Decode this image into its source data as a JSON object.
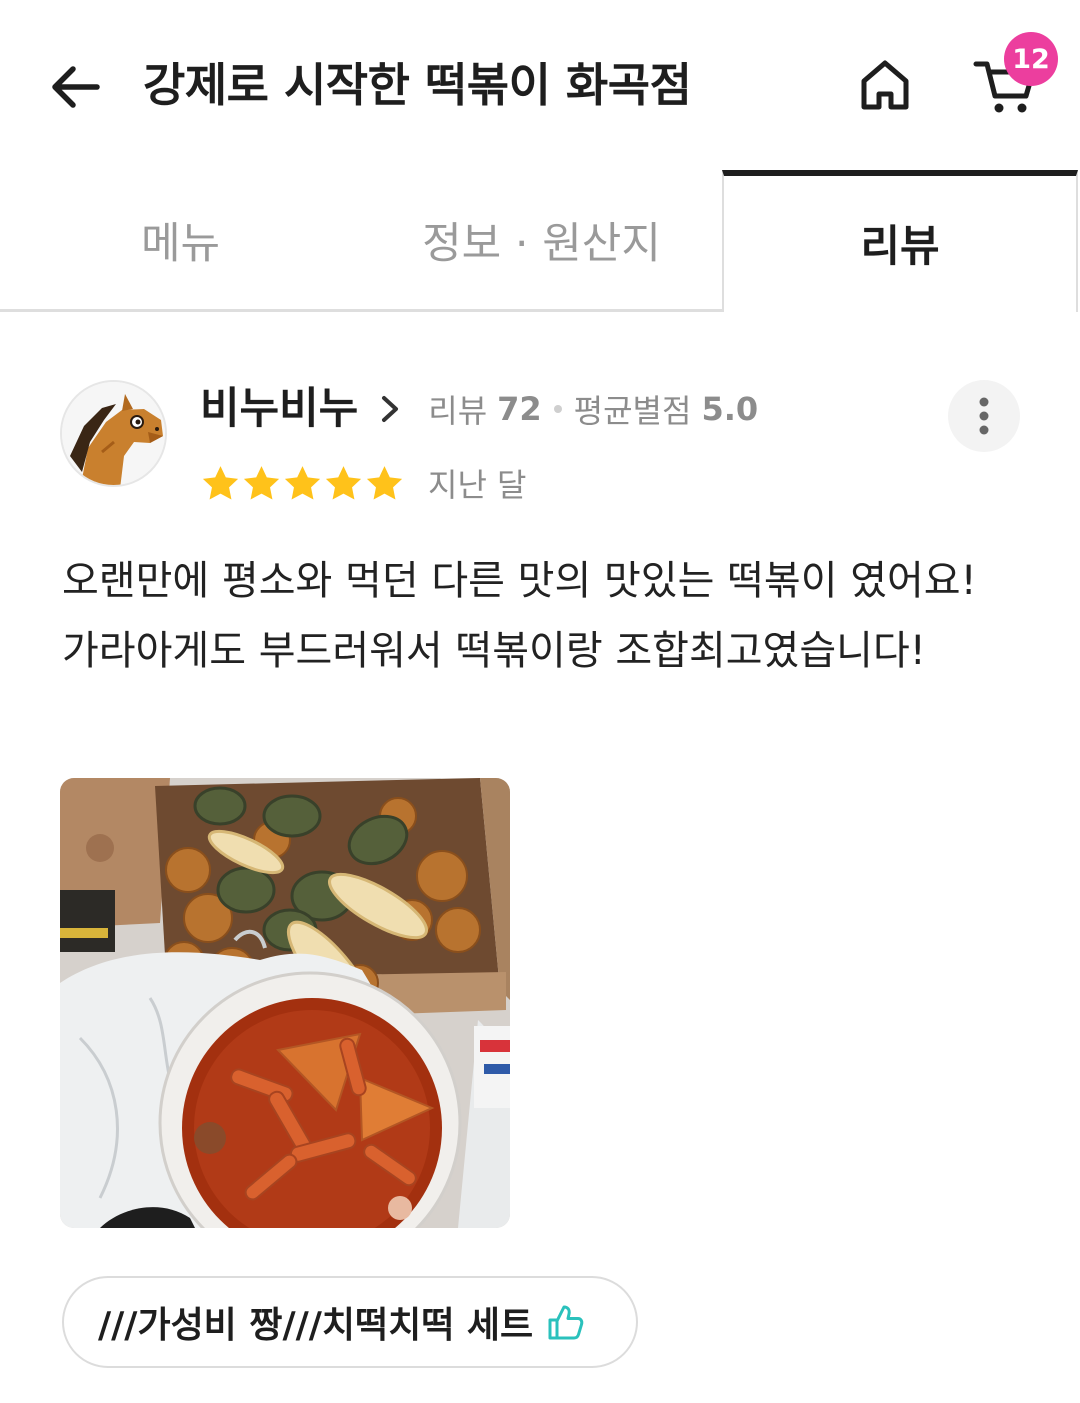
{
  "header": {
    "title": "강제로 시작한 떡볶이 화곡점",
    "cart_count": "12"
  },
  "tabs": [
    {
      "label": "메뉴",
      "active": false
    },
    {
      "label": "정보 · 원산지",
      "active": false
    },
    {
      "label": "리뷰",
      "active": true
    }
  ],
  "review": {
    "author": "비누비누",
    "review_count_label": "리뷰",
    "review_count": "72",
    "avg_rating_label": "평균별점",
    "avg_rating": "5.0",
    "rating": 5,
    "rating_max": 5,
    "date": "지난 달",
    "text": "오랜만에 평소와 먹던 다른 맛의 맛있는 떡볶이 였어요! 가라아게도 부드러워서 떡볶이랑 조합최고였습니다!",
    "menu_tag": "///가성비 짱///치떡치떡 세트"
  },
  "icons": {
    "back": "arrow-left-icon",
    "home": "home-icon",
    "cart": "cart-icon",
    "author_link": "chevron-right-icon",
    "more": "more-vertical-icon",
    "star": "star-icon",
    "menu_tag": "thumbs-up-icon"
  },
  "colors": {
    "text_primary": "#1e1e1e",
    "text_secondary": "#8c8c8c",
    "badge": "#ec3e9e",
    "star": "#ffc21a",
    "star_empty": "#dddddd",
    "tag_icon": "#2ac1bc"
  }
}
